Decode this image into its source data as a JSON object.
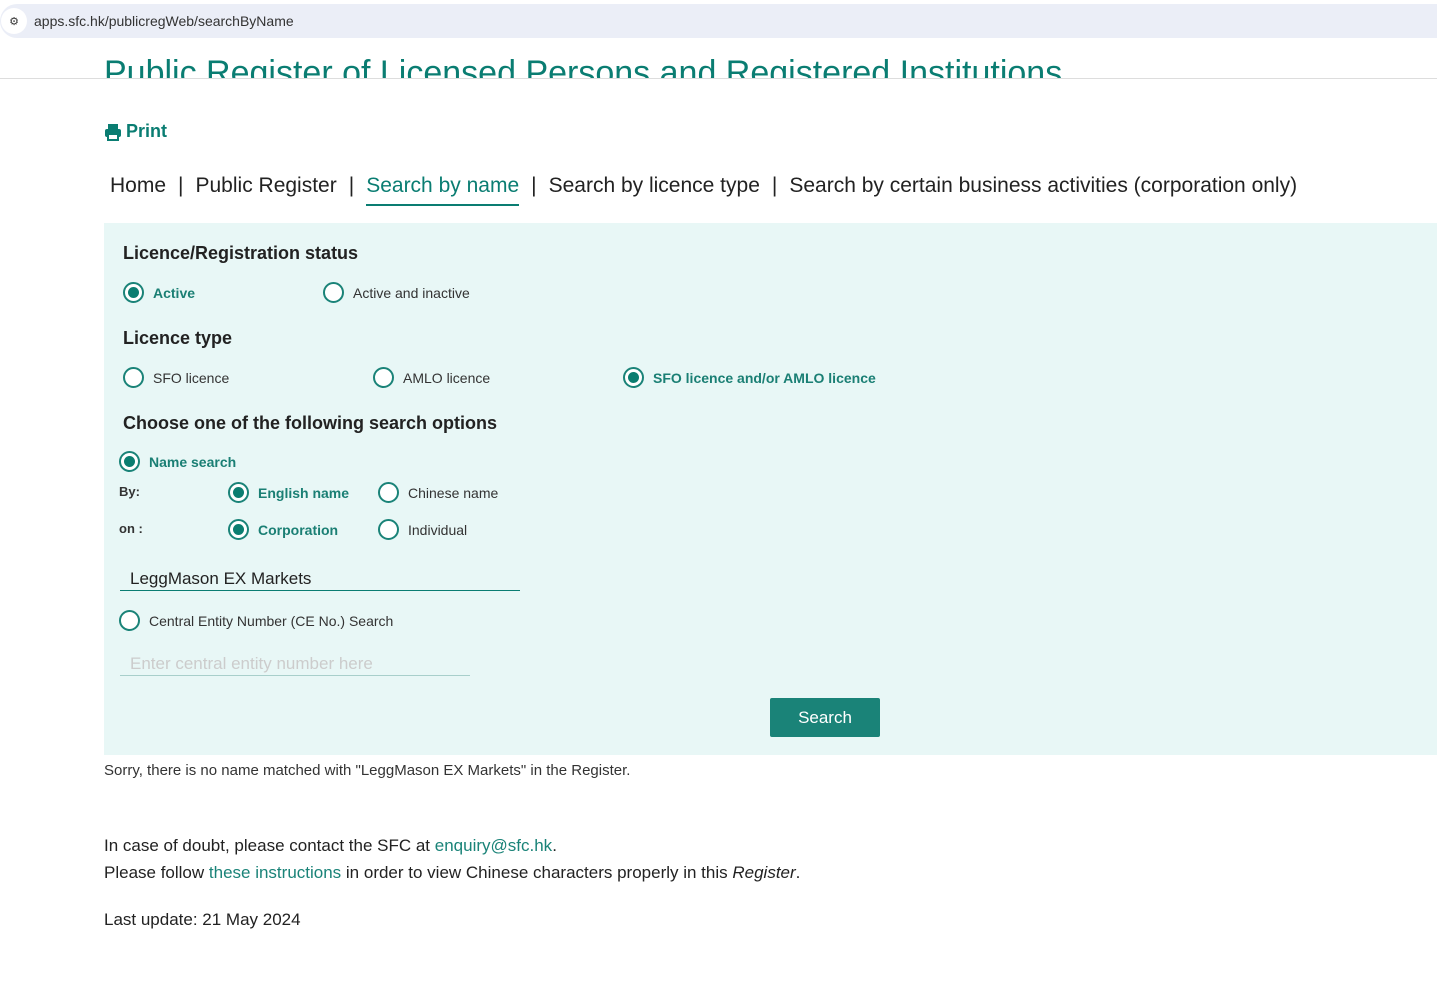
{
  "browser": {
    "url": "apps.sfc.hk/publicregWeb/searchByName"
  },
  "page": {
    "title": "Public Register of Licensed Persons and Registered Institutions",
    "print": "Print"
  },
  "nav": {
    "items": [
      "Home",
      "Public Register",
      "Search by name",
      "Search by licence type",
      "Search by certain business activities (corporation only)"
    ],
    "separator": "|"
  },
  "form": {
    "status_heading": "Licence/Registration status",
    "status_options": [
      "Active",
      "Active and inactive"
    ],
    "licence_heading": "Licence type",
    "licence_options": [
      "SFO licence",
      "AMLO licence",
      "SFO licence and/or AMLO licence"
    ],
    "search_heading": "Choose one of the following search options",
    "name_search": "Name search",
    "by_label": "By:",
    "by_options": [
      "English name",
      "Chinese name"
    ],
    "on_label": "on :",
    "on_options": [
      "Corporation",
      "Individual"
    ],
    "name_value": "LeggMason EX Markets",
    "ce_search": "Central Entity Number (CE No.) Search",
    "ce_placeholder": "Enter central entity number here",
    "search_button": "Search"
  },
  "result": {
    "message": "Sorry, there is no name matched with \"LeggMason EX Markets\" in the Register."
  },
  "footer": {
    "doubt_prefix": "In case of doubt, please contact the SFC at ",
    "email": "enquiry@sfc.hk",
    "doubt_suffix": ".",
    "follow_prefix": "Please follow ",
    "instructions_link": "these instructions ",
    "follow_middle": "in order to view Chinese characters properly in this ",
    "register_word": "Register",
    "follow_suffix": ".",
    "last_update": "Last update: 21 May 2024"
  },
  "colors": {
    "accent": "#0a7d72",
    "panel_bg": "#e8f7f6",
    "button": "#1a8378"
  }
}
